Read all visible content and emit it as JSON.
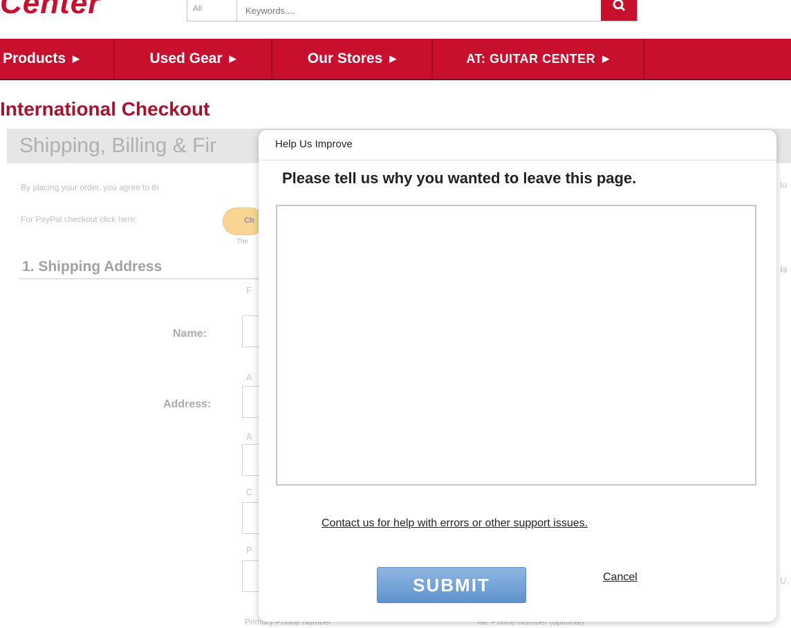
{
  "header": {
    "logo_text": "Center",
    "search": {
      "scope_label": "All",
      "placeholder": "Keywords...."
    }
  },
  "nav": {
    "items": [
      {
        "label": "Products"
      },
      {
        "label": "Used Gear"
      },
      {
        "label": "Our Stores"
      },
      {
        "label": "AT: GUITAR CENTER"
      }
    ]
  },
  "page": {
    "title": "International Checkout"
  },
  "background_form": {
    "section_title": "Shipping, Billing & Fir",
    "agree_text": "By placing your order, you agree to th",
    "paypal_text": "For PayPal checkout click here:",
    "paypal_button_text": "Ch",
    "paypal_sub": "The",
    "shipping_heading": "1. Shipping Address",
    "name_label": "Name:",
    "address_label": "Address:",
    "phone_left": "Primary Phone Number",
    "phone_right": "Alt. Phone Number (optional)"
  },
  "modal": {
    "title": "Help Us Improve",
    "question": "Please tell us why you wanted to leave this page.",
    "feedback_value": "",
    "contact_link": "Contact us for help with errors or other support issues.",
    "submit_label": "SUBMIT",
    "cancel_label": "Cancel"
  },
  "colors": {
    "brand_red": "#c8102e",
    "title_red": "#a4142c",
    "submit_blue": "#6b9dd4"
  }
}
